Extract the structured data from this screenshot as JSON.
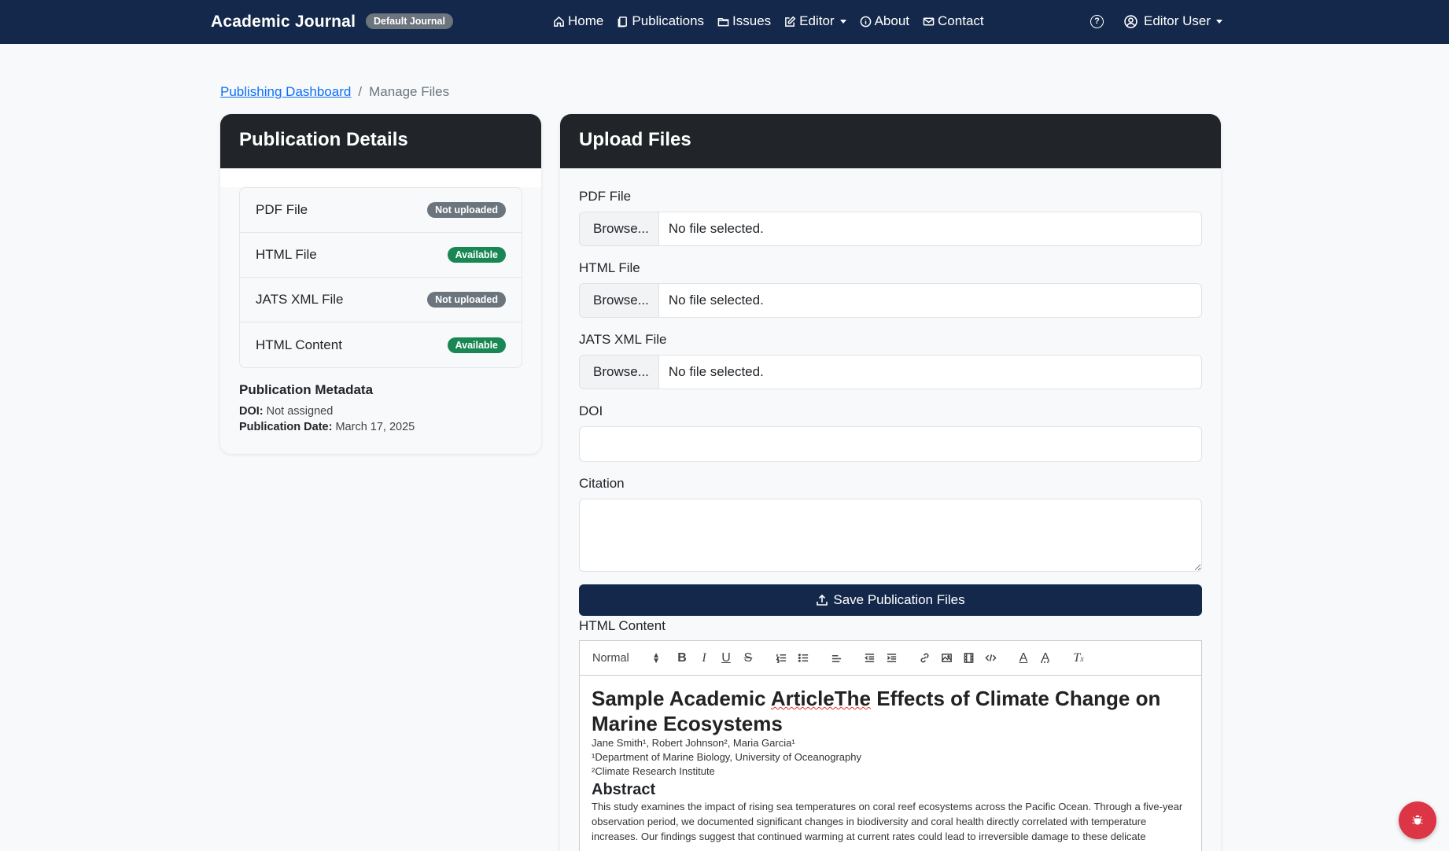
{
  "navbar": {
    "brand": "Academic Journal",
    "journal_badge": "Default Journal",
    "items": [
      {
        "label": "Home",
        "icon": "house-icon"
      },
      {
        "label": "Publications",
        "icon": "journals-icon"
      },
      {
        "label": "Issues",
        "icon": "folder-icon"
      },
      {
        "label": "Editor",
        "icon": "pencil-square-icon"
      },
      {
        "label": "About",
        "icon": "info-circle-icon"
      },
      {
        "label": "Contact",
        "icon": "envelope-icon"
      }
    ],
    "help_label": "?",
    "user_label": "Editor User"
  },
  "breadcrumb": {
    "parent": "Publishing Dashboard",
    "separator": "/",
    "current": "Manage Files"
  },
  "details": {
    "title": "Publication Details",
    "files": [
      {
        "name": "PDF File",
        "status": "Not uploaded",
        "state": "gray"
      },
      {
        "name": "HTML File",
        "status": "Available",
        "state": "green"
      },
      {
        "name": "JATS XML File",
        "status": "Not uploaded",
        "state": "gray"
      },
      {
        "name": "HTML Content",
        "status": "Available",
        "state": "green"
      }
    ],
    "metadata": {
      "heading": "Publication Metadata",
      "doi_label": "DOI:",
      "doi_value": "Not assigned",
      "date_label": "Publication Date:",
      "date_value": "March 17, 2025"
    }
  },
  "upload": {
    "title": "Upload Files",
    "pdf_label": "PDF File",
    "html_label": "HTML File",
    "jats_label": "JATS XML File",
    "browse_label": "Browse...",
    "no_file": "No file selected.",
    "doi_label": "DOI",
    "doi_value": "",
    "citation_label": "Citation",
    "citation_value": "",
    "save_label": "Save Publication Files",
    "html_content_label": "HTML Content"
  },
  "editor": {
    "format_select": "Normal",
    "title_part1": "Sample Academic ",
    "title_spell": "ArticleThe",
    "title_part2": " Effects of Climate Change on Marine Ecosystems",
    "authors": "Jane Smith¹, Robert Johnson², Maria Garcia¹",
    "affil1": "¹Department of Marine Biology, University of Oceanography",
    "affil2": "²Climate Research Institute",
    "abstract_heading": "Abstract",
    "abstract_text": "This study examines the impact of rising sea temperatures on coral reef ecosystems across the Pacific Ocean. Through a five-year observation period, we documented significant changes in biodiversity and coral health directly correlated with temperature increases. Our findings suggest that continued warming at current rates could lead to irreversible damage to these delicate"
  },
  "colors": {
    "navbar": "#14284b",
    "card_header": "#212529",
    "primary_button": "#14284b",
    "success": "#198754",
    "secondary": "#6c757d",
    "danger": "#dc3545",
    "link": "#0d6efd"
  }
}
